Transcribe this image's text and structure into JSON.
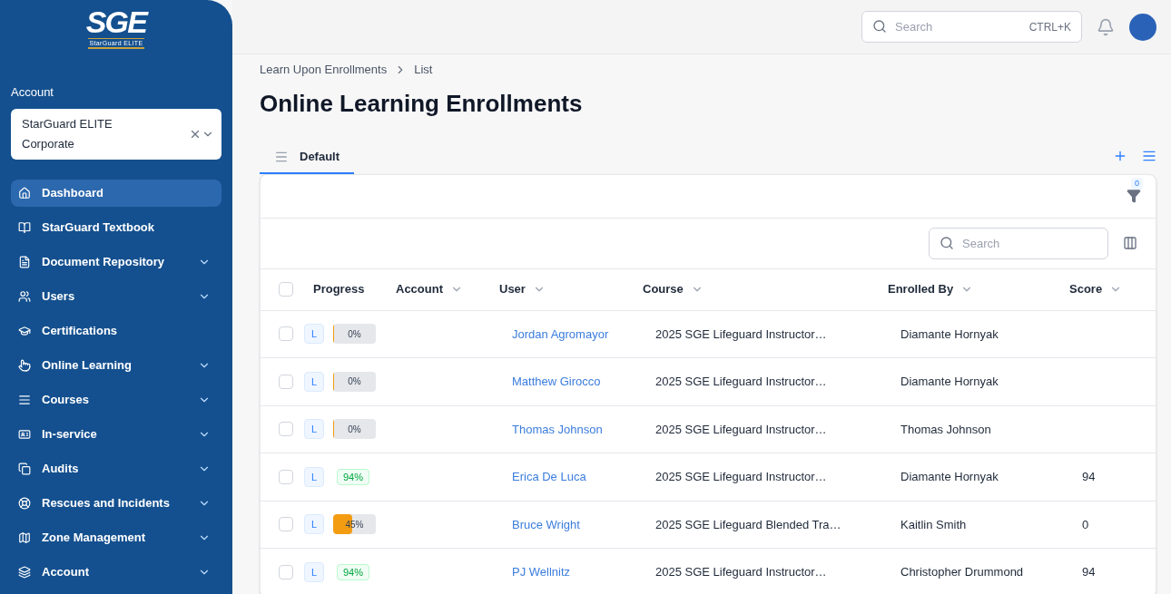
{
  "sidebar": {
    "logo": {
      "mark": "SGE",
      "name": "StarGuard ELITE"
    },
    "account_label": "Account",
    "account_select": {
      "value": "StarGuard ELITE Corporate"
    },
    "items": [
      {
        "label": "Dashboard",
        "selected": true,
        "expandable": false
      },
      {
        "label": "StarGuard Textbook",
        "selected": false,
        "expandable": false
      },
      {
        "label": "Document Repository",
        "selected": false,
        "expandable": true
      },
      {
        "label": "Users",
        "selected": false,
        "expandable": true
      },
      {
        "label": "Certifications",
        "selected": false,
        "expandable": false
      },
      {
        "label": "Online Learning",
        "selected": false,
        "expandable": true
      },
      {
        "label": "Courses",
        "selected": false,
        "expandable": true
      },
      {
        "label": "In-service",
        "selected": false,
        "expandable": true
      },
      {
        "label": "Audits",
        "selected": false,
        "expandable": true
      },
      {
        "label": "Rescues and Incidents",
        "selected": false,
        "expandable": true
      },
      {
        "label": "Zone Management",
        "selected": false,
        "expandable": true
      },
      {
        "label": "Account",
        "selected": false,
        "expandable": true
      }
    ]
  },
  "topbar": {
    "search": {
      "placeholder": "Search",
      "shortcut": "CTRL+K"
    }
  },
  "breadcrumbs": [
    "Learn Upon Enrollments",
    "List"
  ],
  "title": "Online Learning Enrollments",
  "tabs": [
    {
      "label": "Default",
      "selected": true
    }
  ],
  "filter": {
    "count": "0"
  },
  "table": {
    "search": {
      "placeholder": "Search"
    },
    "select_all": {
      "checked": false
    },
    "columns": [
      "Progress",
      "Account",
      "User",
      "Course",
      "Enrolled By",
      "Score"
    ],
    "rows": [
      {
        "checked": false,
        "source": "L",
        "progress": {
          "kind": "bar",
          "text": "0%",
          "level": 0
        },
        "user": "Jordan Agromayor",
        "course": "2025 SGE Lifeguard Instructor…",
        "enrolled_by": "Diamante Hornyak",
        "score": ""
      },
      {
        "checked": false,
        "source": "L",
        "progress": {
          "kind": "bar",
          "text": "0%",
          "level": 0
        },
        "user": "Matthew Girocco",
        "course": "2025 SGE Lifeguard Instructor…",
        "enrolled_by": "Diamante Hornyak",
        "score": ""
      },
      {
        "checked": false,
        "source": "L",
        "progress": {
          "kind": "bar",
          "text": "0%",
          "level": 0
        },
        "user": "Thomas Johnson",
        "course": "2025 SGE Lifeguard Instructor…",
        "enrolled_by": "Thomas Johnson",
        "score": ""
      },
      {
        "checked": false,
        "source": "L",
        "progress": {
          "kind": "badge",
          "text": "94%"
        },
        "user": "Erica De Luca",
        "course": "2025 SGE Lifeguard Instructor…",
        "enrolled_by": "Diamante Hornyak",
        "score": "94"
      },
      {
        "checked": false,
        "source": "L",
        "progress": {
          "kind": "bar",
          "text": "45%",
          "level": 0.45
        },
        "user": "Bruce Wright",
        "course": "2025 SGE Lifeguard Blended Tra…",
        "enrolled_by": "Kaitlin Smith",
        "score": "0"
      },
      {
        "checked": false,
        "source": "L",
        "progress": {
          "kind": "badge",
          "text": "94%"
        },
        "user": "PJ Wellnitz",
        "course": "2025 SGE Lifeguard Instructor…",
        "enrolled_by": "Christopher Drummond",
        "score": "94"
      }
    ]
  }
}
